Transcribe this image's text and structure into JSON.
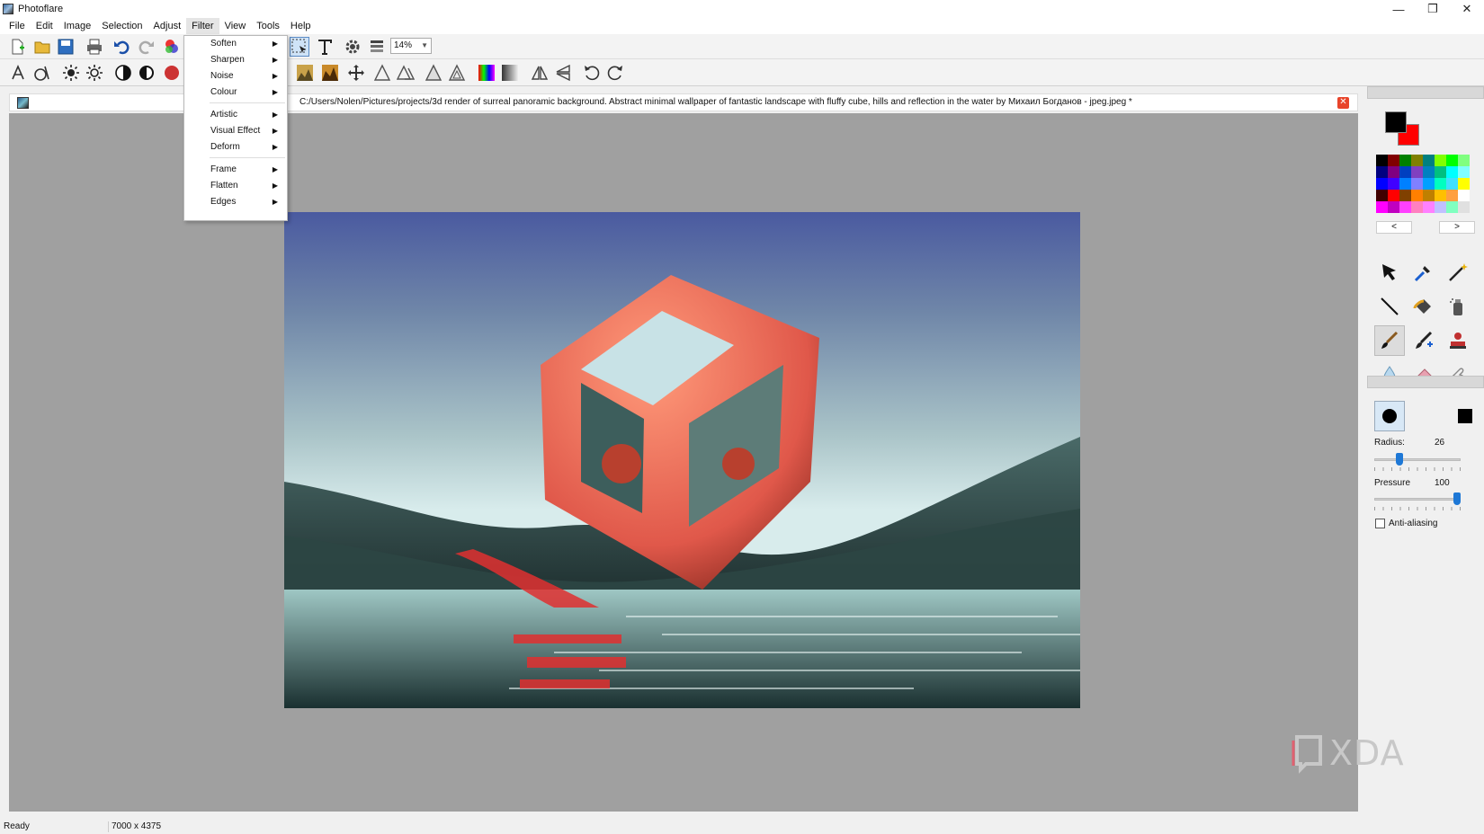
{
  "window": {
    "title": "Photoflare"
  },
  "menubar": {
    "items": [
      "File",
      "Edit",
      "Image",
      "Selection",
      "Adjust",
      "Filter",
      "View",
      "Tools",
      "Help"
    ]
  },
  "toolbar": {
    "zoom": "14%"
  },
  "document": {
    "path": "C:/Users/Nolen/Pictures/projects/3d render of surreal panoramic background. Abstract minimal wallpaper of fantastic landscape with fluffy cube, hills and reflection in the water by Михаил Богданов - jpeg.jpeg *"
  },
  "filter_menu": {
    "items": [
      "Soften",
      "Sharpen",
      "Noise",
      "Colour",
      "Artistic",
      "Visual Effect",
      "Deform",
      "Frame",
      "Flatten",
      "Edges"
    ]
  },
  "palette": {
    "fg": "#000000",
    "bg": "#ff0000",
    "prev_label": "<",
    "next_label": ">",
    "colors": [
      "#000000",
      "#800000",
      "#008000",
      "#808000",
      "#008080",
      "#80ff00",
      "#00ff00",
      "#80ff80",
      "#000080",
      "#800080",
      "#0040c0",
      "#8040c0",
      "#0080c0",
      "#00c080",
      "#00ffff",
      "#80ffff",
      "#0000ff",
      "#4000ff",
      "#0080ff",
      "#8080ff",
      "#00a0ff",
      "#00ffc0",
      "#40e0ff",
      "#ffff00",
      "#400000",
      "#ff0000",
      "#804000",
      "#ff8000",
      "#c08000",
      "#ffc000",
      "#ffa040",
      "#ffffff",
      "#ff00ff",
      "#c000c0",
      "#ff40ff",
      "#ff80c0",
      "#ff80ff",
      "#c0c0ff",
      "#80ffc0",
      "#e0e0e0"
    ]
  },
  "brush": {
    "radius_label": "Radius:",
    "radius_value": "26",
    "radius_fraction": 0.27,
    "pressure_label": "Pressure",
    "pressure_value": "100",
    "pressure_fraction": 1.0,
    "antialias_label": "Anti-aliasing",
    "antialias_checked": false
  },
  "status": {
    "ready": "Ready",
    "dimensions": "7000 x 4375"
  },
  "watermark": {
    "text": "XDA"
  }
}
